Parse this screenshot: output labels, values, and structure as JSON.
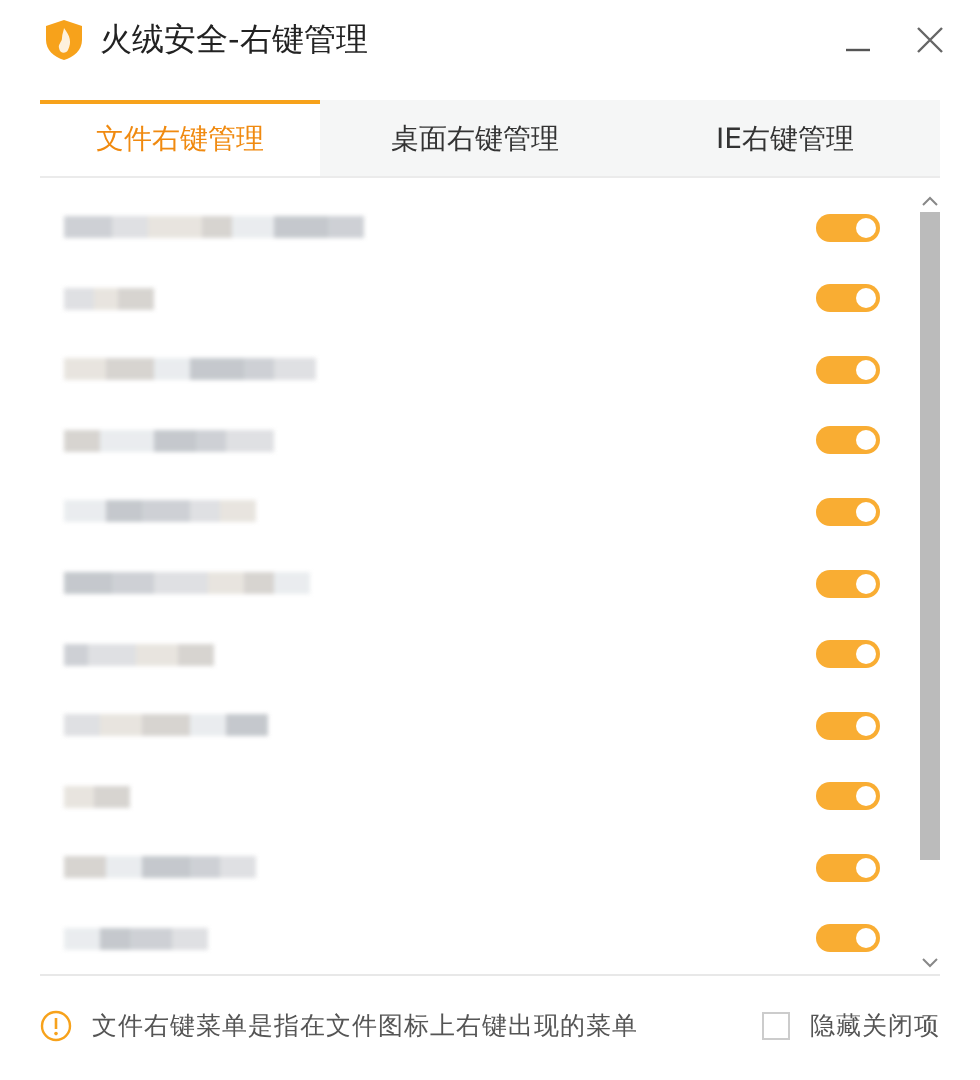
{
  "window": {
    "title": "火绒安全-右键管理"
  },
  "tabs": [
    {
      "label": "文件右键管理",
      "selected": true
    },
    {
      "label": "桌面右键管理",
      "selected": false
    },
    {
      "label": "IE右键管理",
      "selected": false
    }
  ],
  "items": [
    {
      "on": true
    },
    {
      "on": true
    },
    {
      "on": true
    },
    {
      "on": true
    },
    {
      "on": true
    },
    {
      "on": true
    },
    {
      "on": true
    },
    {
      "on": true
    },
    {
      "on": true
    },
    {
      "on": true
    },
    {
      "on": true
    }
  ],
  "footer": {
    "hint": "文件右键菜单是指在文件图标上右键出现的菜单",
    "hide_closed": {
      "label": "隐藏关闭项",
      "checked": false
    }
  }
}
